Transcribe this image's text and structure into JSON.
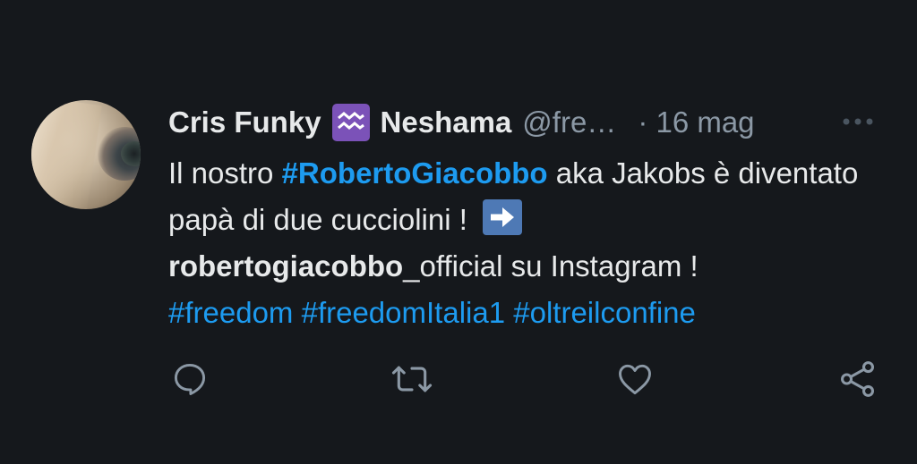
{
  "tweet": {
    "author_name": "Cris Funky",
    "author_name2": "Neshama",
    "handle": "@fre…",
    "time": "· 16 mag",
    "zodiac_icon": "aquarius-sign-icon",
    "text": {
      "part1": "Il nostro ",
      "hashtag1": "#RobertoGiacobbo",
      "part2": " aka Jakobs è diventato papà di due cucciolini ! ",
      "mention": "robertogiacobbo",
      "part3": "_official su Instagram !",
      "hashtag2": "#freedom",
      "hashtag3": "#freedomItalia1",
      "hashtag4": "#oltreilconfine"
    }
  },
  "colors": {
    "background": "#15181c",
    "text": "#e7e9ea",
    "secondary": "#8b98a5",
    "link": "#1d9bf0",
    "zodiac_bg": "#7b52b8",
    "arrow_bg": "#4e79b5"
  },
  "icons": {
    "more": "more-horizontal-icon",
    "reply": "reply-icon",
    "retweet": "retweet-icon",
    "like": "heart-icon",
    "share": "share-icon",
    "arrow": "right-arrow-emoji-icon"
  }
}
